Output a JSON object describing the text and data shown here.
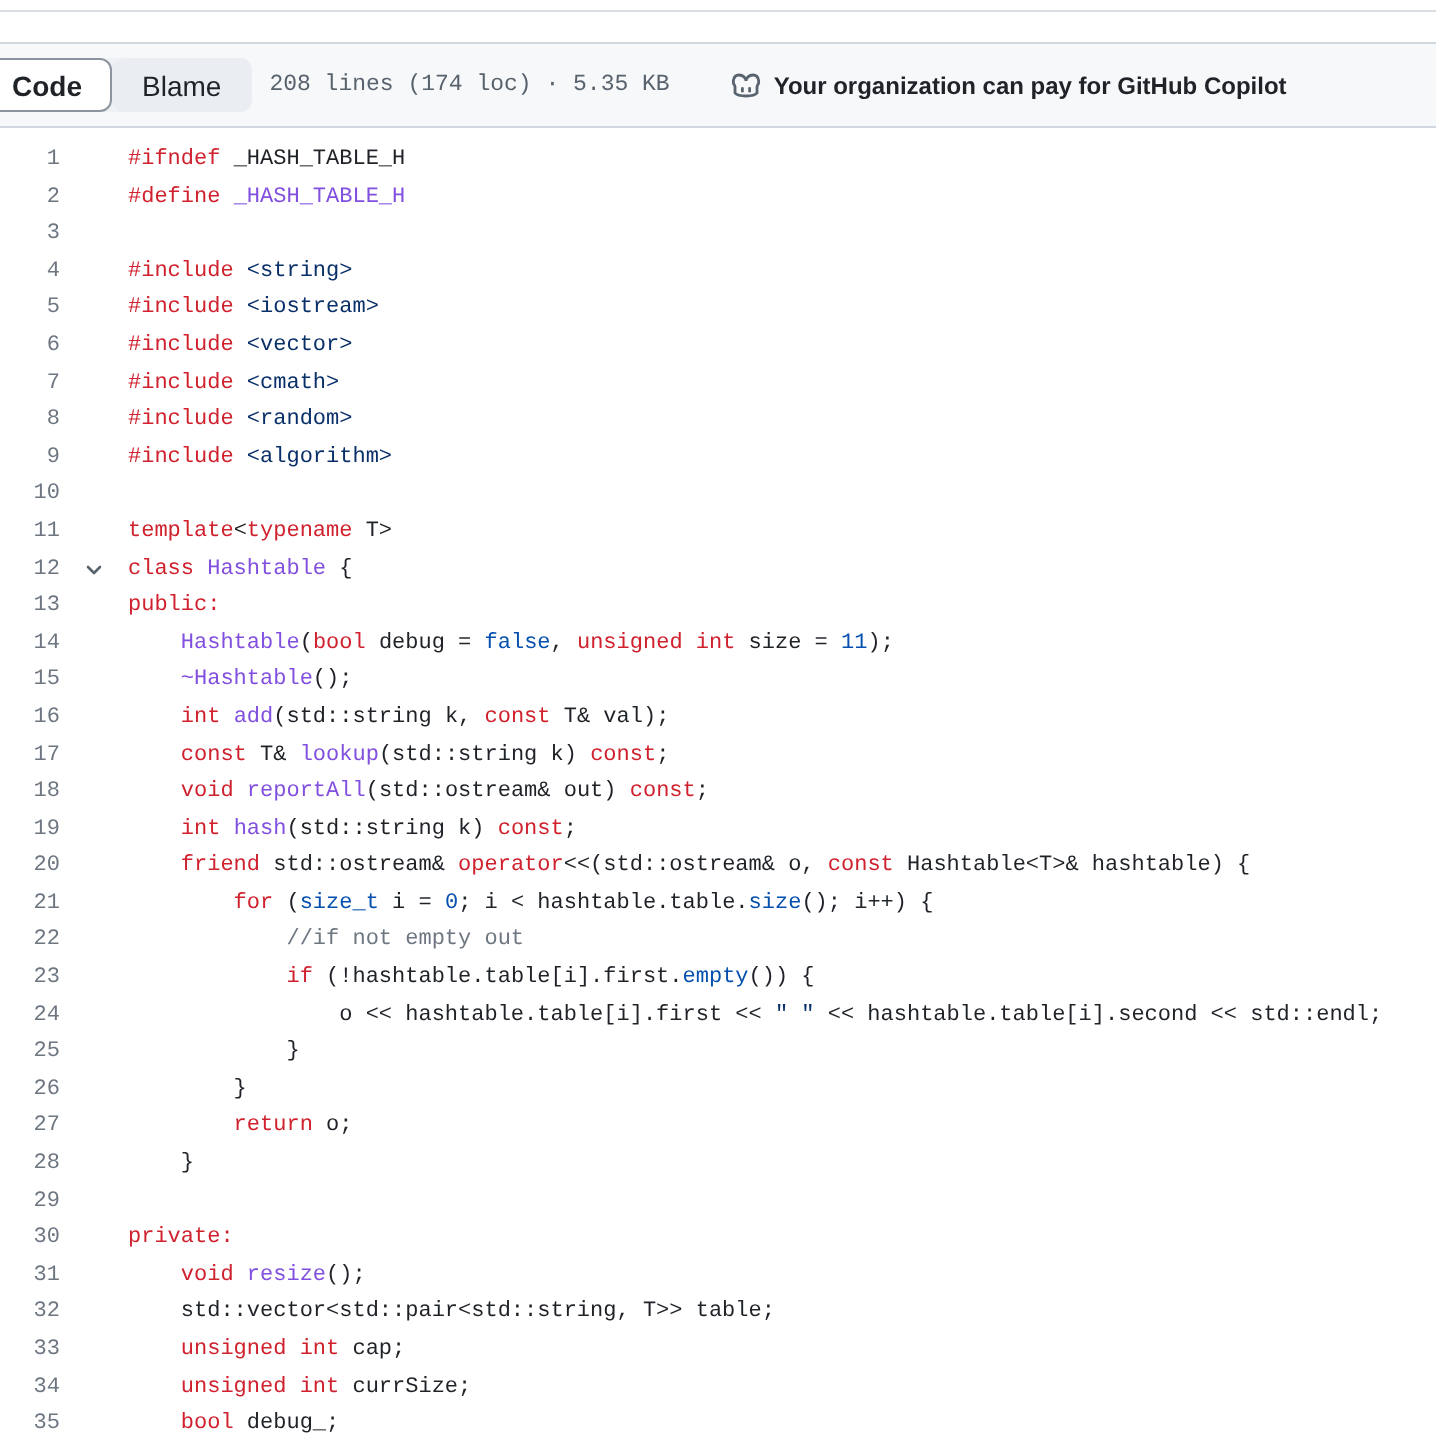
{
  "toolbar": {
    "tabs": [
      {
        "label": "Code",
        "selected": true
      },
      {
        "label": "Blame",
        "selected": false
      }
    ],
    "file_info": "208 lines (174 loc) · 5.35 KB",
    "copilot_notice": "Your organization can pay for GitHub Copilot"
  },
  "code": {
    "lines": [
      {
        "number": "1",
        "tokens": [
          {
            "text": "#ifndef",
            "kind": "keyword"
          },
          {
            "text": " _HASH_TABLE_H",
            "kind": "plain"
          }
        ]
      },
      {
        "number": "2",
        "tokens": [
          {
            "text": "#define ",
            "kind": "keyword"
          },
          {
            "text": "_HASH_TABLE_H",
            "kind": "entity"
          }
        ]
      },
      {
        "number": "3"
      },
      {
        "number": "4",
        "tokens": [
          {
            "text": "#include ",
            "kind": "keyword"
          },
          {
            "text": "<string>",
            "kind": "string"
          }
        ]
      },
      {
        "number": "5",
        "tokens": [
          {
            "text": "#include ",
            "kind": "keyword"
          },
          {
            "text": "<iostream>",
            "kind": "string"
          }
        ]
      },
      {
        "number": "6",
        "tokens": [
          {
            "text": "#include ",
            "kind": "keyword"
          },
          {
            "text": "<vector>",
            "kind": "string"
          }
        ]
      },
      {
        "number": "7",
        "tokens": [
          {
            "text": "#include ",
            "kind": "keyword"
          },
          {
            "text": "<cmath>",
            "kind": "string"
          }
        ]
      },
      {
        "number": "8",
        "tokens": [
          {
            "text": "#include ",
            "kind": "keyword"
          },
          {
            "text": "<random>",
            "kind": "string"
          }
        ]
      },
      {
        "number": "9",
        "tokens": [
          {
            "text": "#include ",
            "kind": "keyword"
          },
          {
            "text": "<algorithm>",
            "kind": "string"
          }
        ]
      },
      {
        "number": "10"
      },
      {
        "number": "11",
        "tokens": [
          {
            "text": "template",
            "kind": "keyword"
          },
          {
            "text": "<",
            "kind": "plain"
          },
          {
            "text": "typename",
            "kind": "keyword"
          },
          {
            "text": " T>",
            "kind": "plain"
          }
        ]
      },
      {
        "number": "12",
        "fold": {
          "expanded": true
        },
        "tokens": [
          {
            "text": "class ",
            "kind": "keyword"
          },
          {
            "text": "Hashtable",
            "kind": "entity"
          },
          {
            "text": " {",
            "kind": "plain"
          }
        ]
      },
      {
        "number": "13",
        "tokens": [
          {
            "text": "public:",
            "kind": "keyword"
          }
        ]
      },
      {
        "number": "14",
        "tokens": [
          {
            "text": "    Hashtable",
            "kind": "entity"
          },
          {
            "text": "(",
            "kind": "plain"
          },
          {
            "text": "bool",
            "kind": "keyword"
          },
          {
            "text": " debug = ",
            "kind": "plain"
          },
          {
            "text": "false",
            "kind": "constant"
          },
          {
            "text": ", ",
            "kind": "plain"
          },
          {
            "text": "unsigned int",
            "kind": "keyword"
          },
          {
            "text": " size = ",
            "kind": "plain"
          },
          {
            "text": "11",
            "kind": "constant"
          },
          {
            "text": ");",
            "kind": "plain"
          }
        ]
      },
      {
        "number": "15",
        "tokens": [
          {
            "text": "    ~Hashtable",
            "kind": "entity"
          },
          {
            "text": "();",
            "kind": "plain"
          }
        ]
      },
      {
        "number": "16",
        "tokens": [
          {
            "text": "    int ",
            "kind": "keyword"
          },
          {
            "text": "add",
            "kind": "entity"
          },
          {
            "text": "(std::string k, ",
            "kind": "plain"
          },
          {
            "text": "const",
            "kind": "keyword"
          },
          {
            "text": " T& val);",
            "kind": "plain"
          }
        ]
      },
      {
        "number": "17",
        "tokens": [
          {
            "text": "    const",
            "kind": "keyword"
          },
          {
            "text": " T& ",
            "kind": "plain"
          },
          {
            "text": "lookup",
            "kind": "entity"
          },
          {
            "text": "(std::string k) ",
            "kind": "plain"
          },
          {
            "text": "const",
            "kind": "keyword"
          },
          {
            "text": ";",
            "kind": "plain"
          }
        ]
      },
      {
        "number": "18",
        "tokens": [
          {
            "text": "    void ",
            "kind": "keyword"
          },
          {
            "text": "reportAll",
            "kind": "entity"
          },
          {
            "text": "(std::ostream& out) ",
            "kind": "plain"
          },
          {
            "text": "const",
            "kind": "keyword"
          },
          {
            "text": ";",
            "kind": "plain"
          }
        ]
      },
      {
        "number": "19",
        "tokens": [
          {
            "text": "    int ",
            "kind": "keyword"
          },
          {
            "text": "hash",
            "kind": "entity"
          },
          {
            "text": "(std::string k) ",
            "kind": "plain"
          },
          {
            "text": "const",
            "kind": "keyword"
          },
          {
            "text": ";",
            "kind": "plain"
          }
        ]
      },
      {
        "number": "20",
        "tokens": [
          {
            "text": "    friend",
            "kind": "keyword"
          },
          {
            "text": " std::ostream& ",
            "kind": "plain"
          },
          {
            "text": "operator",
            "kind": "keyword"
          },
          {
            "text": "<<(std::ostream& o, ",
            "kind": "plain"
          },
          {
            "text": "const",
            "kind": "keyword"
          },
          {
            "text": " Hashtable<T>& hashtable) {",
            "kind": "plain"
          }
        ]
      },
      {
        "number": "21",
        "tokens": [
          {
            "text": "        for",
            "kind": "keyword"
          },
          {
            "text": " (",
            "kind": "plain"
          },
          {
            "text": "size_t",
            "kind": "constant"
          },
          {
            "text": " i = ",
            "kind": "plain"
          },
          {
            "text": "0",
            "kind": "constant"
          },
          {
            "text": "; i < hashtable.table.",
            "kind": "plain"
          },
          {
            "text": "size",
            "kind": "constant"
          },
          {
            "text": "(); i++) {",
            "kind": "plain"
          }
        ]
      },
      {
        "number": "22",
        "tokens": [
          {
            "text": "            //if not empty out",
            "kind": "comment"
          }
        ]
      },
      {
        "number": "23",
        "tokens": [
          {
            "text": "            if",
            "kind": "keyword"
          },
          {
            "text": " (!hashtable.table[i].first.",
            "kind": "plain"
          },
          {
            "text": "empty",
            "kind": "constant"
          },
          {
            "text": "()) {",
            "kind": "plain"
          }
        ]
      },
      {
        "number": "24",
        "tokens": [
          {
            "text": "                o << hashtable.table[i].first << ",
            "kind": "plain"
          },
          {
            "text": "\" \"",
            "kind": "string"
          },
          {
            "text": " << hashtable.table[i].second << std::endl;",
            "kind": "plain"
          }
        ]
      },
      {
        "number": "25",
        "tokens": [
          {
            "text": "            }",
            "kind": "plain"
          }
        ]
      },
      {
        "number": "26",
        "tokens": [
          {
            "text": "        }",
            "kind": "plain"
          }
        ]
      },
      {
        "number": "27",
        "tokens": [
          {
            "text": "        return",
            "kind": "keyword"
          },
          {
            "text": " o;",
            "kind": "plain"
          }
        ]
      },
      {
        "number": "28",
        "tokens": [
          {
            "text": "    }",
            "kind": "plain"
          }
        ]
      },
      {
        "number": "29"
      },
      {
        "number": "30",
        "tokens": [
          {
            "text": "private:",
            "kind": "keyword"
          }
        ]
      },
      {
        "number": "31",
        "tokens": [
          {
            "text": "    void ",
            "kind": "keyword"
          },
          {
            "text": "resize",
            "kind": "entity"
          },
          {
            "text": "();",
            "kind": "plain"
          }
        ]
      },
      {
        "number": "32",
        "tokens": [
          {
            "text": "    std::vector<std::pair<std::string, T>> table;",
            "kind": "plain"
          }
        ]
      },
      {
        "number": "33",
        "tokens": [
          {
            "text": "    unsigned int",
            "kind": "keyword"
          },
          {
            "text": " cap;",
            "kind": "plain"
          }
        ]
      },
      {
        "number": "34",
        "tokens": [
          {
            "text": "    unsigned int",
            "kind": "keyword"
          },
          {
            "text": " currSize;",
            "kind": "plain"
          }
        ]
      },
      {
        "number": "35",
        "tokens": [
          {
            "text": "    bool",
            "kind": "keyword"
          },
          {
            "text": " debug_;",
            "kind": "plain"
          }
        ]
      }
    ]
  }
}
